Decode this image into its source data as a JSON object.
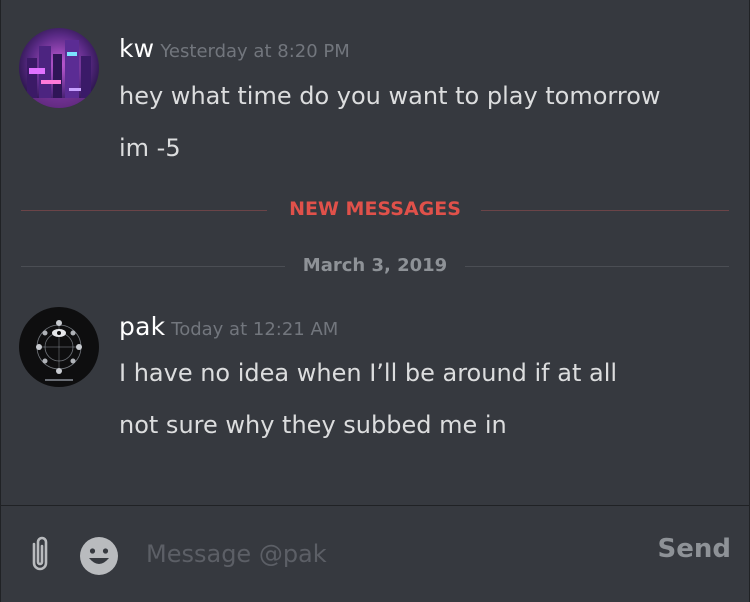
{
  "messages": [
    {
      "author": "kw",
      "timestamp": "Yesterday at 8:20 PM",
      "lines": [
        "hey what time do you want to play tomorrow",
        "im -5"
      ]
    },
    {
      "author": "pak",
      "timestamp": "Today at 12:21 AM",
      "lines": [
        "I have no idea when I’ll be around if at all",
        "not sure why they subbed me in"
      ]
    }
  ],
  "dividers": {
    "new_messages": "NEW MESSAGES",
    "date": "March 3, 2019"
  },
  "composer": {
    "placeholder": "Message @pak",
    "send_label": "Send"
  },
  "colors": {
    "background": "#36393f",
    "new_messages": "#e0514a",
    "muted": "#72767d",
    "text": "#dcddde"
  }
}
